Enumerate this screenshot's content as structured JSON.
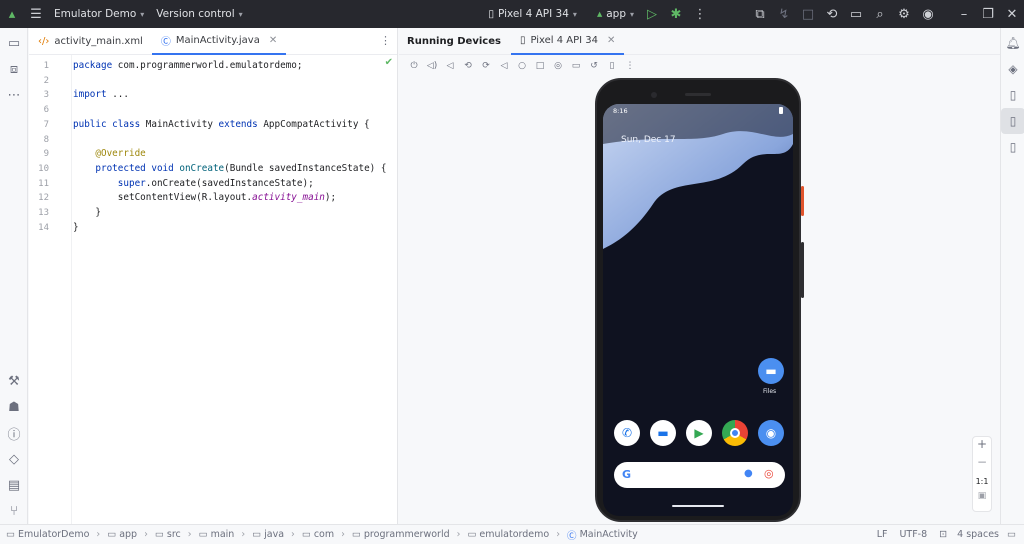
{
  "topbar": {
    "project": "Emulator Demo",
    "vcs": "Version control",
    "device": "Pixel 4 API 34",
    "run_config": "app"
  },
  "editor": {
    "tabs": [
      {
        "label": "activity_main.xml"
      },
      {
        "label": "MainActivity.java"
      }
    ],
    "lines": [
      {
        "n": "1",
        "t": [
          [
            "kw",
            "package "
          ],
          [
            "",
            "com.programmerworld.emulatordemo;"
          ]
        ]
      },
      {
        "n": "2",
        "t": []
      },
      {
        "n": "3",
        "t": [
          [
            "kw",
            "import "
          ],
          [
            "",
            "..."
          ]
        ]
      },
      {
        "n": "6",
        "t": []
      },
      {
        "n": "7",
        "t": [
          [
            "kw",
            "public class "
          ],
          [
            "",
            "MainActivity "
          ],
          [
            "kw",
            "extends "
          ],
          [
            "",
            "AppCompatActivity {"
          ]
        ]
      },
      {
        "n": "8",
        "t": []
      },
      {
        "n": "9",
        "t": [
          [
            "ann",
            "    @Override"
          ]
        ]
      },
      {
        "n": "10",
        "t": [
          [
            "kw",
            "    protected void "
          ],
          [
            "fn",
            "onCreate"
          ],
          [
            "",
            "(Bundle savedInstanceState) {"
          ]
        ]
      },
      {
        "n": "11",
        "t": [
          [
            "kw",
            "        super"
          ],
          [
            "",
            ".onCreate(savedInstanceState);"
          ]
        ]
      },
      {
        "n": "12",
        "t": [
          [
            "",
            "        setContentView(R.layout."
          ],
          [
            "it",
            "activity_main"
          ],
          [
            "",
            ");"
          ]
        ]
      },
      {
        "n": "13",
        "t": [
          [
            "",
            "    }"
          ]
        ]
      },
      {
        "n": "14",
        "t": [
          [
            "",
            "}"
          ]
        ]
      }
    ]
  },
  "devices": {
    "title": "Running Devices",
    "tab": "Pixel 4 API 34"
  },
  "phone": {
    "time": "8:16",
    "date": "Sun, Dec 17",
    "files_label": "Files"
  },
  "zoom": {
    "ratio": "1:1"
  },
  "breadcrumb": [
    "EmulatorDemo",
    "app",
    "src",
    "main",
    "java",
    "com",
    "programmerworld",
    "emulatordemo",
    "MainActivity"
  ],
  "status": {
    "line_sep": "LF",
    "encoding": "UTF-8",
    "indent": "4 spaces"
  },
  "colors": {
    "accent": "#3574f0",
    "topbar": "#27282e",
    "run": "#5fb865"
  }
}
